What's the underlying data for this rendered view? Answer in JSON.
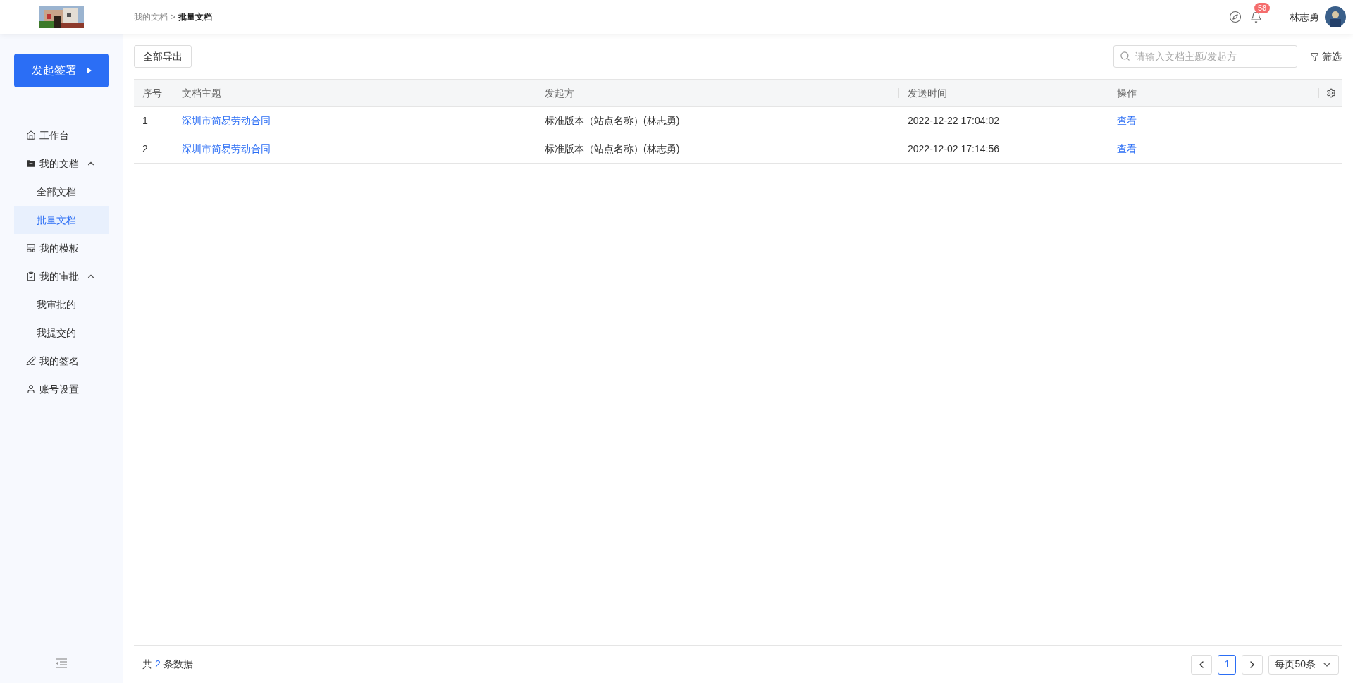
{
  "header": {
    "breadcrumb": [
      {
        "label": "我的文档",
        "current": false
      },
      {
        "label": ">",
        "current": false
      },
      {
        "label": "批量文档",
        "current": true
      }
    ],
    "notification_count": "58",
    "user_name": "林志勇"
  },
  "sidebar": {
    "start_button": "发起签署",
    "items": [
      {
        "label": "工作台",
        "kind": "home",
        "selected": false
      },
      {
        "label": "我的文档",
        "kind": "folder",
        "selected": false,
        "expanded": true,
        "children": [
          {
            "label": "全部文档",
            "selected": false
          },
          {
            "label": "批量文档",
            "selected": true
          }
        ]
      },
      {
        "label": "我的模板",
        "kind": "template",
        "selected": false
      },
      {
        "label": "我的审批",
        "kind": "approval",
        "selected": false,
        "expanded": true,
        "children": [
          {
            "label": "我审批的",
            "selected": false
          },
          {
            "label": "我提交的",
            "selected": false
          }
        ]
      },
      {
        "label": "我的签名",
        "kind": "signature",
        "selected": false
      },
      {
        "label": "账号设置",
        "kind": "account",
        "selected": false
      }
    ]
  },
  "toolbar": {
    "export_button": "全部导出",
    "search": {
      "placeholder": "请输入文档主题/发起方"
    },
    "filter": "筛选"
  },
  "table": {
    "columns": [
      "序号",
      "文档主题",
      "发起方",
      "发送时间",
      "操作"
    ],
    "rows": [
      {
        "index": "1",
        "subject": "深圳市简易劳动合同",
        "sender": "标准版本（站点名称）(林志勇)",
        "sent_at": "2022-12-22 17:04:02",
        "action": "查看"
      },
      {
        "index": "2",
        "subject": "深圳市简易劳动合同",
        "sender": "标准版本（站点名称）(林志勇)",
        "sent_at": "2022-12-02 17:14:56",
        "action": "查看"
      }
    ]
  },
  "footer": {
    "total_prefix": "共",
    "total_count": "2",
    "total_suffix": "条数据",
    "pages": [
      {
        "label": "1",
        "selected": true
      }
    ],
    "page_size": "每页50条"
  }
}
